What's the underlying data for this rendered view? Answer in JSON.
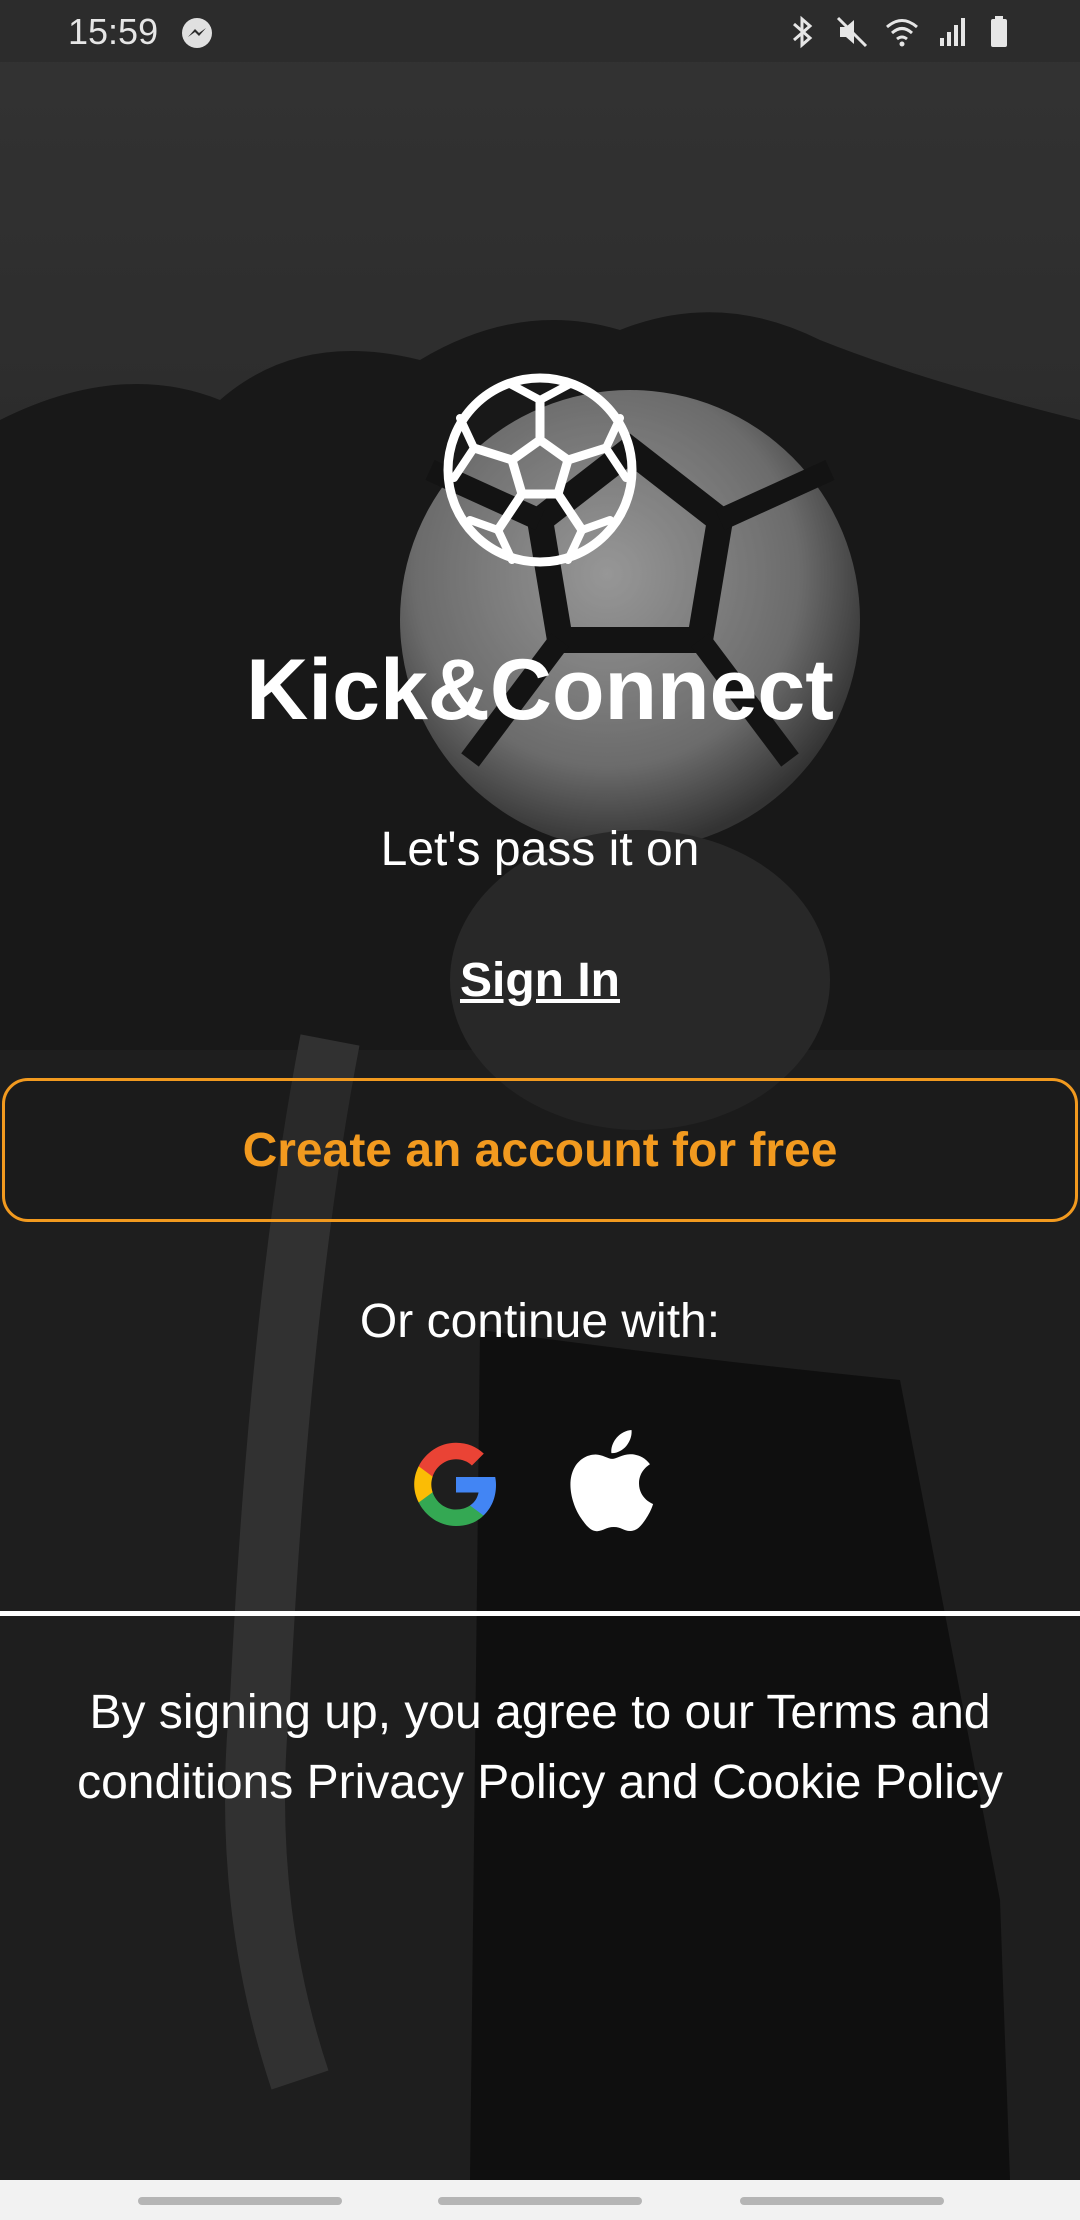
{
  "status_bar": {
    "time": "15:59",
    "icons": [
      "messenger-icon",
      "bluetooth-icon",
      "mute-icon",
      "wifi-icon",
      "signal-icon",
      "battery-icon"
    ]
  },
  "app": {
    "title": "Kick&Connect",
    "tagline": "Let's pass it on",
    "logo_icon": "soccer-ball-icon"
  },
  "auth": {
    "sign_in_label": "Sign In",
    "create_account_label": "Create an account for free",
    "continue_with_label": "Or continue with:",
    "providers": [
      "google-icon",
      "apple-icon"
    ]
  },
  "footer": {
    "terms_text": "By signing up, you agree to our Terms and conditions Privacy Policy and Cookie Policy"
  },
  "colors": {
    "accent": "#f29a1f",
    "text": "#ffffff",
    "status_bar_bg": "#2c2c2c",
    "nav_bar_bg": "#f2f2f2"
  }
}
